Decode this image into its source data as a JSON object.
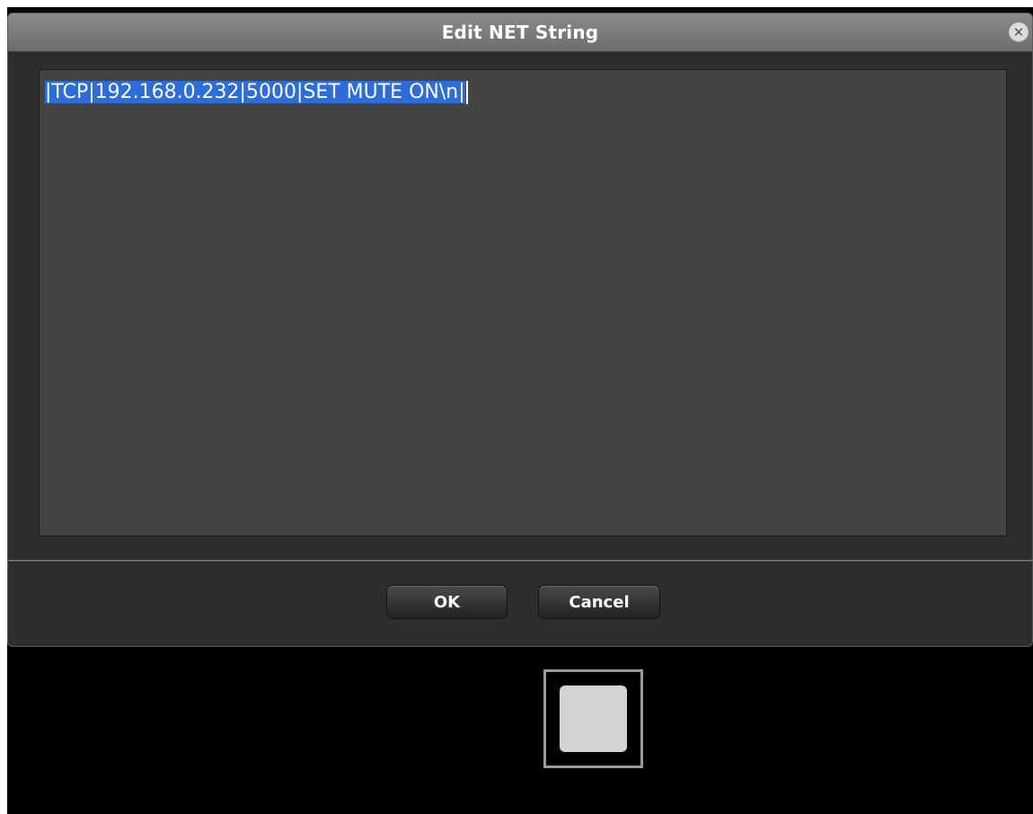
{
  "dialog": {
    "title": "Edit NET String",
    "close_icon": "close-icon",
    "text_value": "|TCP|192.168.0.232|5000|SET MUTE ON\\n|",
    "ok_label": "OK",
    "cancel_label": "Cancel"
  },
  "colors": {
    "selection": "#2c6ddb",
    "textarea_bg": "#444444",
    "dialog_bg": "#2d2d2d",
    "titlebar": "#7b7b7b"
  }
}
